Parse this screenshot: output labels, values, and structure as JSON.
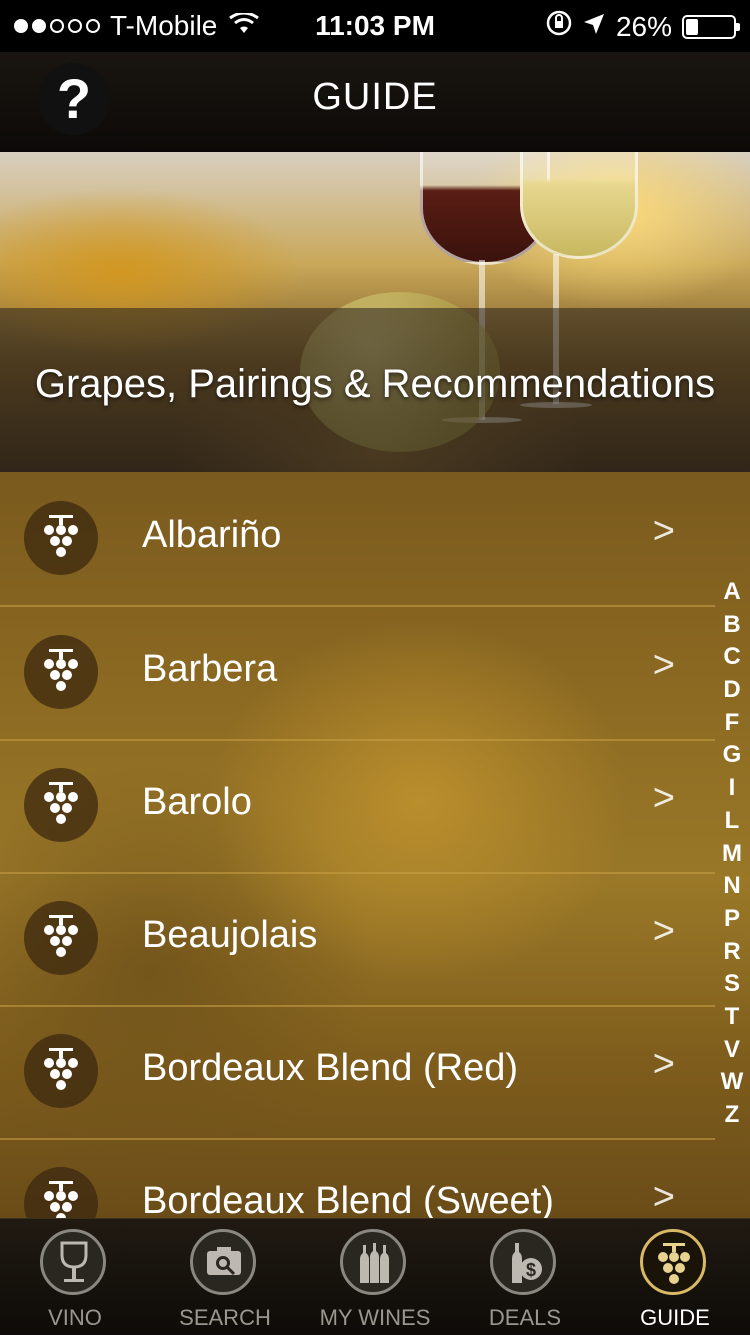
{
  "status_bar": {
    "carrier": "T-Mobile",
    "time": "11:03 PM",
    "battery_percent": "26%",
    "battery_level": 0.26,
    "signal_dots_filled": 2,
    "signal_dots_total": 5,
    "icons": [
      "wifi-icon",
      "orientation-lock-icon",
      "location-arrow-icon",
      "battery-icon"
    ]
  },
  "nav": {
    "title": "GUIDE",
    "help_label": "?"
  },
  "hero": {
    "title": "Grapes, Pairings & Recommendations"
  },
  "list": {
    "items": [
      {
        "label": "Albariño",
        "icon": "grape-icon"
      },
      {
        "label": "Barbera",
        "icon": "grape-icon"
      },
      {
        "label": "Barolo",
        "icon": "grape-icon"
      },
      {
        "label": "Beaujolais",
        "icon": "grape-icon"
      },
      {
        "label": "Bordeaux Blend (Red)",
        "icon": "grape-icon"
      },
      {
        "label": "Bordeaux Blend (Sweet)",
        "icon": "grape-icon"
      }
    ],
    "chevron": ">"
  },
  "index_letters": [
    "A",
    "B",
    "C",
    "D",
    "F",
    "G",
    "I",
    "L",
    "M",
    "N",
    "P",
    "R",
    "S",
    "T",
    "V",
    "W",
    "Z"
  ],
  "tabs": [
    {
      "label": "VINO",
      "icon": "wine-glass-icon",
      "active": false
    },
    {
      "label": "SEARCH",
      "icon": "camera-search-icon",
      "active": false
    },
    {
      "label": "MY WINES",
      "icon": "bottles-icon",
      "active": false
    },
    {
      "label": "DEALS",
      "icon": "dollar-bottle-icon",
      "active": false
    },
    {
      "label": "GUIDE",
      "icon": "grape-icon",
      "active": true
    }
  ],
  "colors": {
    "accent_gold": "#d9b866",
    "list_background": "#8c6a22",
    "tab_inactive": "#9a968f"
  }
}
